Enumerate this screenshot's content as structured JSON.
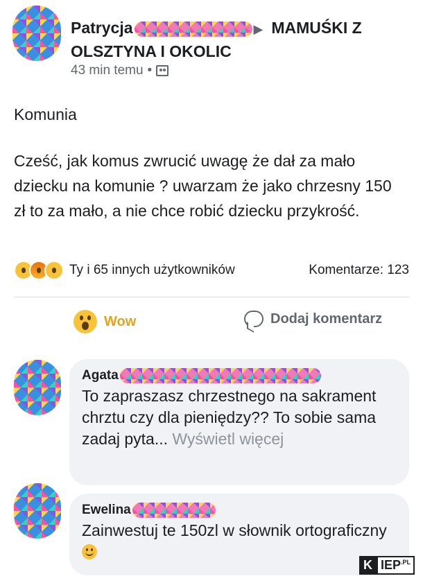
{
  "post": {
    "author": "Patrycja",
    "group": "MAMUŚKI Z OLSZTYNA I OKOLIC",
    "time": "43 min temu",
    "separator": "•",
    "title": "Komunia",
    "body": "Cześć, jak komus zwrucić uwagę że dał za mało dziecku na komunie ? uwarzam że jako chrzesny 150 zł to za mało, a nie chce robić dziecku przykrość."
  },
  "reactions": {
    "icons": [
      "haha-reaction-icon",
      "angry-reaction-icon",
      "wow-reaction-icon"
    ],
    "text": "Ty i 65 innych użytkowników",
    "comments_count": "Komentarze: 123"
  },
  "actions": {
    "wow_label": "Wow",
    "comment_label": "Dodaj komentarz"
  },
  "comments": [
    {
      "author": "Agata",
      "text": "To zapraszasz chrzestnego na sakrament chrztu czy dla pieniędzy?? To sobie sama zadaj pyta... ",
      "more": "Wyświetl więcej"
    },
    {
      "author": "Ewelina",
      "text": "Zainwestuj te 150zl w słownik ortograficzny "
    }
  ],
  "watermark": {
    "k": "K",
    "rest": "IEP",
    "pl": ".PL"
  },
  "colors": {
    "accent_wow": "#e8a21a",
    "text_secondary": "#606770",
    "bubble_bg": "#f0f2f5"
  }
}
